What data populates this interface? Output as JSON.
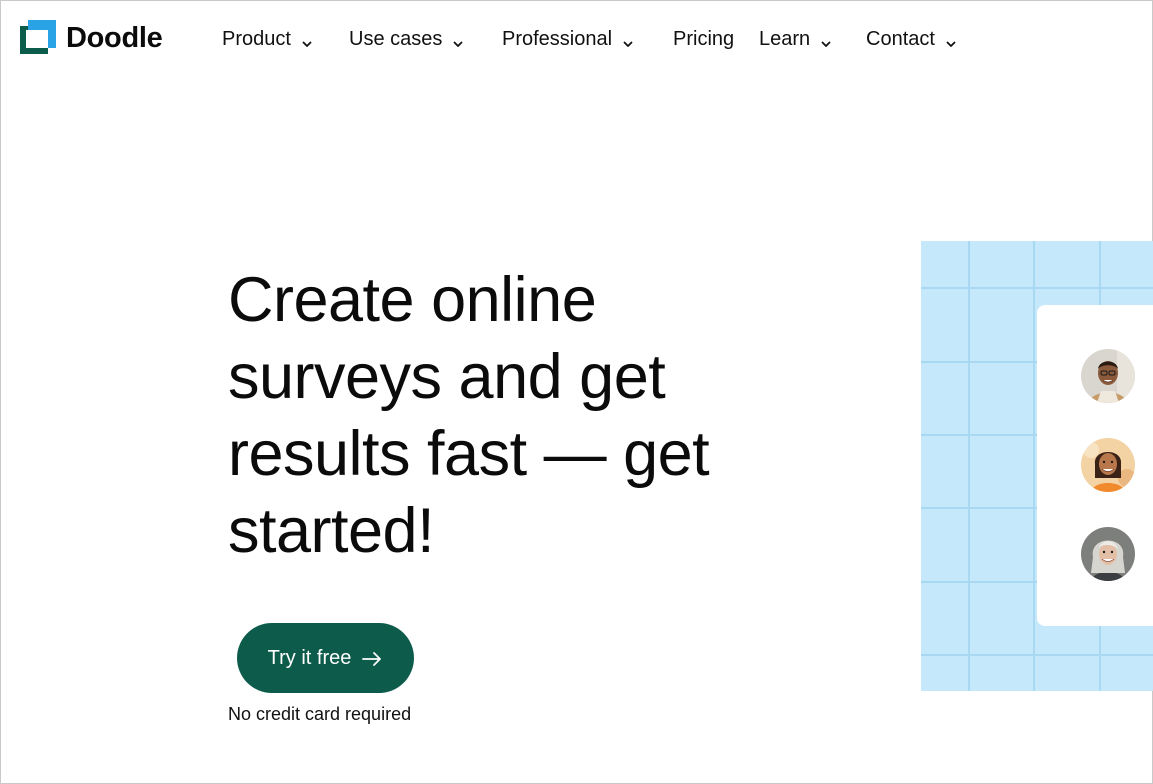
{
  "brand": {
    "name": "Doodle",
    "colors": {
      "logo_dark": "#0b5c4b",
      "logo_light": "#2aa3e6",
      "cta_bg": "#0d5c4b",
      "panel_bg": "#c6e8fb"
    }
  },
  "nav": {
    "items": [
      {
        "label": "Product",
        "has_dropdown": true
      },
      {
        "label": "Use cases",
        "has_dropdown": true
      },
      {
        "label": "Professional",
        "has_dropdown": true
      },
      {
        "label": "Pricing",
        "has_dropdown": false
      },
      {
        "label": "Learn",
        "has_dropdown": true
      },
      {
        "label": "Contact",
        "has_dropdown": true
      }
    ]
  },
  "hero": {
    "title_lines": [
      "Create online",
      "surveys and get",
      "results fast — get",
      "started!"
    ],
    "cta_label": "Try it free",
    "cta_icon": "arrow-right-icon",
    "note": "No credit card required"
  },
  "illustration": {
    "avatars": [
      "avatar-man-smiling",
      "avatar-woman-smiling",
      "avatar-woman-gray-hair"
    ]
  }
}
